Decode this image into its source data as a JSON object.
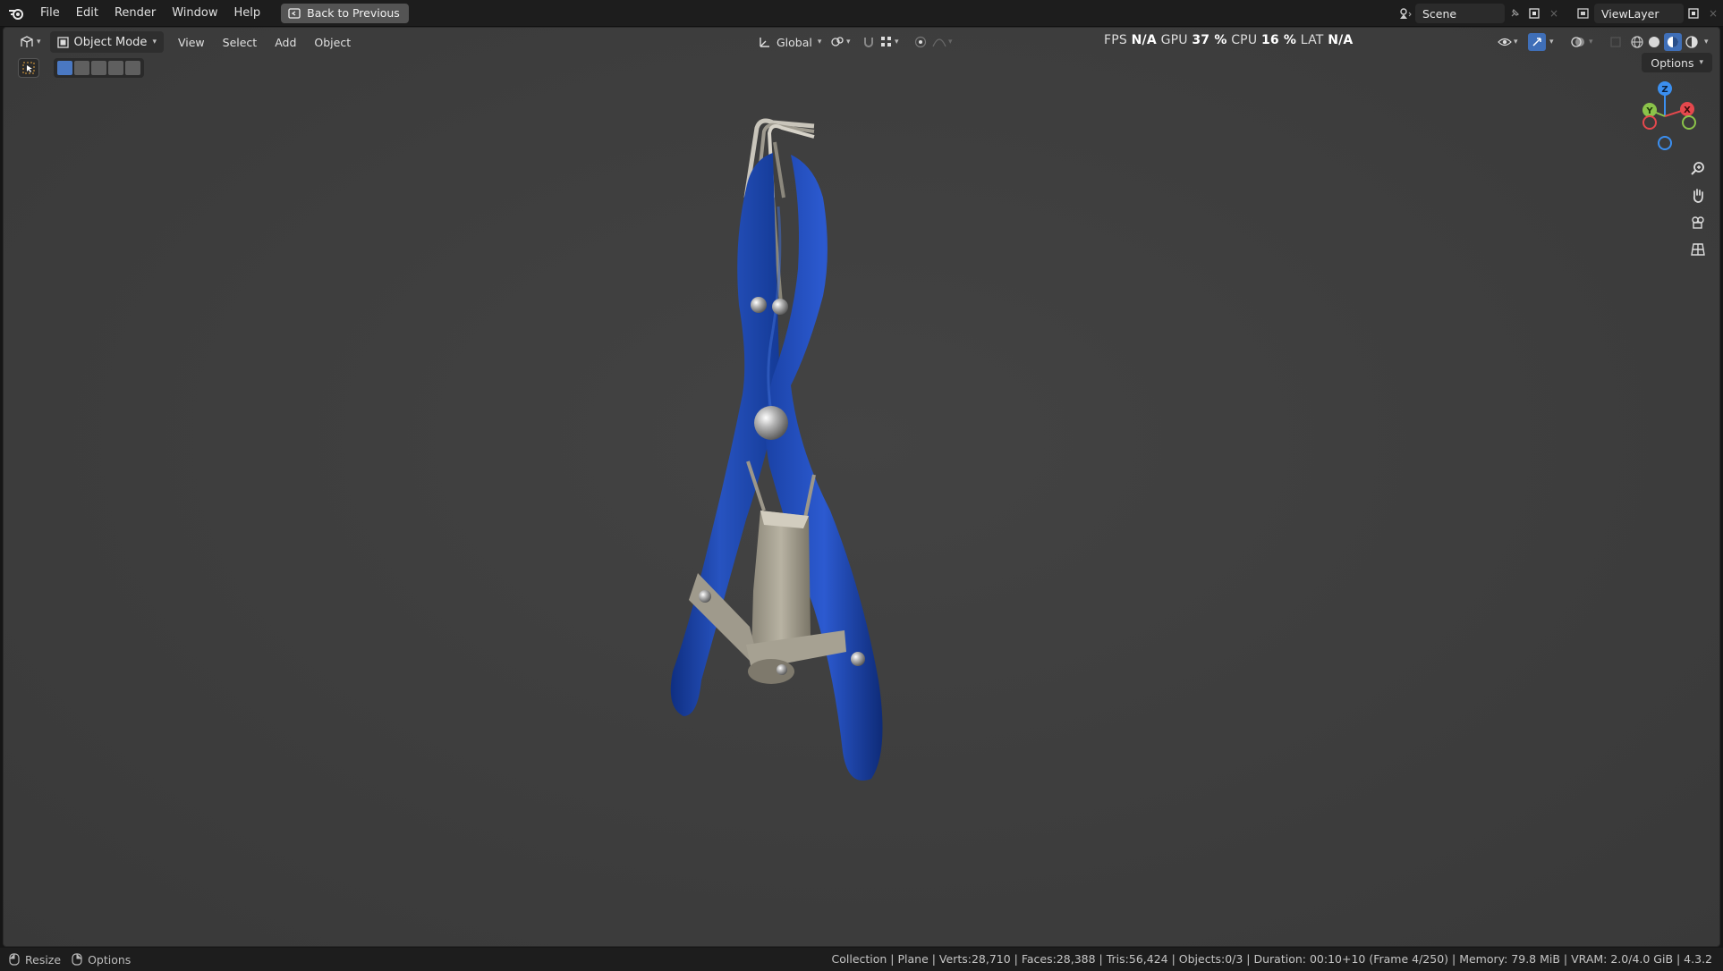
{
  "topbar": {
    "menus": [
      "File",
      "Edit",
      "Render",
      "Window",
      "Help"
    ],
    "back_button": "Back to Previous",
    "scene": "Scene",
    "view_layer": "ViewLayer"
  },
  "viewport_header": {
    "mode": "Object Mode",
    "menus": [
      "View",
      "Select",
      "Add",
      "Object"
    ],
    "transform_orientation": "Global",
    "options": "Options"
  },
  "stats": {
    "fps_label": "FPS",
    "fps_value": "N/A",
    "gpu_label": "GPU",
    "gpu_value": "37 %",
    "cpu_label": "CPU",
    "cpu_value": "16 %",
    "lat_label": "LAT",
    "lat_value": "N/A"
  },
  "gizmo": {
    "x": "X",
    "y": "Y",
    "z": "Z"
  },
  "statusbar": {
    "left_items": [
      "Resize",
      "Options"
    ],
    "info": "Collection | Plane | Verts:28,710 | Faces:28,388 | Tris:56,424 | Objects:0/3 | Duration: 00:10+10 (Frame 4/250) | Memory: 79.8 MiB | VRAM: 2.0/4.0 GiB | 4.3.2"
  },
  "colors": {
    "handle_blue": "#1c46a8",
    "metal": "#a8a293",
    "viewport_bg": "#404040",
    "axis_x": "#e5484d",
    "axis_y": "#8bc34a",
    "axis_z": "#3b8ff0"
  }
}
